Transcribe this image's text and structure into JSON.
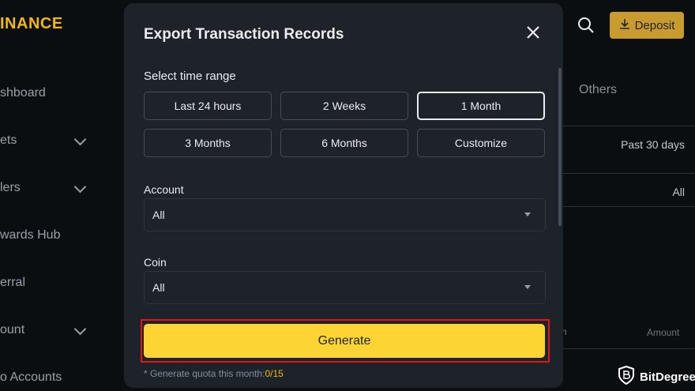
{
  "background": {
    "brand_fragment": "INANCE",
    "sidebar": [
      {
        "label": "shboard",
        "chevron": false
      },
      {
        "label": "ets",
        "chevron": true
      },
      {
        "label": "lers",
        "chevron": true
      },
      {
        "label": "wards Hub",
        "chevron": false
      },
      {
        "label": "erral",
        "chevron": false
      },
      {
        "label": "ount",
        "chevron": true
      },
      {
        "label": "o Accounts",
        "chevron": false
      }
    ],
    "deposit_label": "Deposit",
    "tab_others": "Others",
    "time_value": "Past 30 days",
    "account_value": "All",
    "col_fragment": "n",
    "col_amount": "Amount"
  },
  "modal": {
    "title": "Export Transaction Records",
    "time_range_label": "Select time range",
    "time_options": [
      "Last 24 hours",
      "2 Weeks",
      "1 Month",
      "3 Months",
      "6 Months",
      "Customize"
    ],
    "selected_time_option": "1 Month",
    "account_label": "Account",
    "account_value": "All",
    "coin_label": "Coin",
    "coin_value": "All",
    "generate_label": "Generate",
    "quota_label": "* Generate quota this month:",
    "quota_value": "0/15"
  },
  "watermark": "BitDegree",
  "colors": {
    "accent_yellow": "#fcd535",
    "highlight_red": "#e0161c",
    "modal_bg": "#1e2329",
    "page_bg": "#0b0e11"
  }
}
